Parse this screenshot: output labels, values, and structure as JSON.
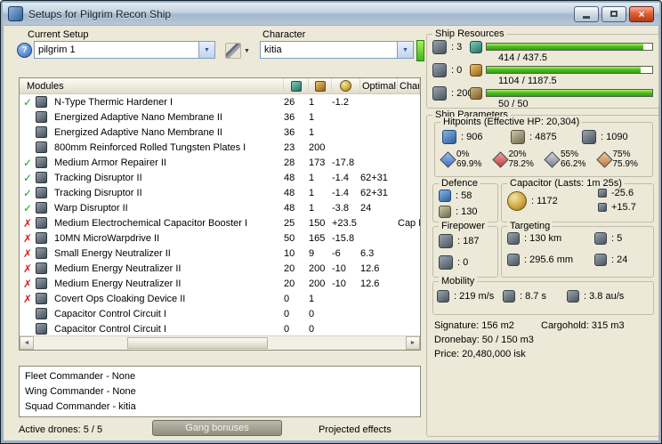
{
  "window": {
    "title": "Setups for Pilgrim Recon Ship"
  },
  "icons": {
    "help": "?",
    "dropdown": "▼",
    "close": "×",
    "scroll_left": "◄",
    "scroll_right": "►",
    "status_ok": "✓",
    "status_off": "✗"
  },
  "top": {
    "current_setup_label": "Current Setup",
    "current_setup_value": "pilgrim 1",
    "character_label": "Character",
    "character_value": "kitia"
  },
  "modules": {
    "header_modules": "Modules",
    "header_optimal": "Optimal",
    "header_charge": "Char",
    "rows": [
      {
        "status": "ok",
        "name": "N-Type Thermic Hardener I",
        "cpu": "26",
        "pg": "1",
        "cap": "-1.2",
        "optimal": "",
        "charge": ""
      },
      {
        "status": "none",
        "name": "Energized Adaptive Nano Membrane II",
        "cpu": "36",
        "pg": "1",
        "cap": "",
        "optimal": "",
        "charge": ""
      },
      {
        "status": "none",
        "name": "Energized Adaptive Nano Membrane II",
        "cpu": "36",
        "pg": "1",
        "cap": "",
        "optimal": "",
        "charge": ""
      },
      {
        "status": "none",
        "name": "800mm Reinforced Rolled Tungsten Plates I",
        "cpu": "23",
        "pg": "200",
        "cap": "",
        "optimal": "",
        "charge": ""
      },
      {
        "status": "ok",
        "name": "Medium Armor Repairer II",
        "cpu": "28",
        "pg": "173",
        "cap": "-17.8",
        "optimal": "",
        "charge": ""
      },
      {
        "status": "ok",
        "name": "Tracking Disruptor II",
        "cpu": "48",
        "pg": "1",
        "cap": "-1.4",
        "optimal": "62+31",
        "charge": ""
      },
      {
        "status": "ok",
        "name": "Tracking Disruptor II",
        "cpu": "48",
        "pg": "1",
        "cap": "-1.4",
        "optimal": "62+31",
        "charge": ""
      },
      {
        "status": "ok",
        "name": "Warp Disruptor II",
        "cpu": "48",
        "pg": "1",
        "cap": "-3.8",
        "optimal": "24",
        "charge": ""
      },
      {
        "status": "off",
        "name": "Medium Electrochemical Capacitor Booster I",
        "cpu": "25",
        "pg": "150",
        "cap": "+23.5",
        "optimal": "",
        "charge": "Cap B"
      },
      {
        "status": "off",
        "name": "10MN MicroWarpdrive II",
        "cpu": "50",
        "pg": "165",
        "cap": "-15.8",
        "optimal": "",
        "charge": ""
      },
      {
        "status": "off",
        "name": "Small Energy Neutralizer II",
        "cpu": "10",
        "pg": "9",
        "cap": "-6",
        "optimal": "6.3",
        "charge": ""
      },
      {
        "status": "off",
        "name": "Medium Energy Neutralizer II",
        "cpu": "20",
        "pg": "200",
        "cap": "-10",
        "optimal": "12.6",
        "charge": ""
      },
      {
        "status": "off",
        "name": "Medium Energy Neutralizer II",
        "cpu": "20",
        "pg": "200",
        "cap": "-10",
        "optimal": "12.6",
        "charge": ""
      },
      {
        "status": "off",
        "name": "Covert Ops Cloaking Device II",
        "cpu": "0",
        "pg": "1",
        "cap": "",
        "optimal": "",
        "charge": ""
      },
      {
        "status": "none",
        "name": "Capacitor Control Circuit I",
        "cpu": "0",
        "pg": "0",
        "cap": "",
        "optimal": "",
        "charge": ""
      },
      {
        "status": "none",
        "name": "Capacitor Control Circuit I",
        "cpu": "0",
        "pg": "0",
        "cap": "",
        "optimal": "",
        "charge": ""
      }
    ]
  },
  "commanders": [
    {
      "label": "Fleet Commander - None"
    },
    {
      "label": "Wing Commander - None"
    },
    {
      "label": "Squad Commander - kitia"
    }
  ],
  "bottom": {
    "active_drones": "Active drones: 5 / 5",
    "gang_bonuses": "Gang bonuses",
    "projected_effects": "Projected effects"
  },
  "resources": {
    "title": "Ship Resources",
    "turrets": ": 3",
    "launchers": ": 0",
    "calibration": ": 200",
    "bars": [
      {
        "label": "414 / 437.5",
        "pct": 94.6
      },
      {
        "label": "1104 / 1187.5",
        "pct": 93
      },
      {
        "label": "50 / 50",
        "pct": 100
      }
    ]
  },
  "parameters": {
    "title": "Ship Parameters",
    "hitpoints": {
      "title": "Hitpoints (Effective HP: 20,304)",
      "shield": ": 906",
      "armor": ": 4875",
      "hull": ": 1090",
      "resists": [
        {
          "type": "em",
          "shield": "0%",
          "armor": "69.9%"
        },
        {
          "type": "th",
          "shield": "20%",
          "armor": "78.2%"
        },
        {
          "type": "ki",
          "shield": "55%",
          "armor": "66.2%"
        },
        {
          "type": "ex",
          "shield": "75%",
          "armor": "75.9%"
        }
      ]
    },
    "defence": {
      "title": "Defence",
      "shield_recharge": ": 58",
      "armor_repair": ": 130"
    },
    "capacitor": {
      "title": "Capacitor (Lasts: 1m 25s)",
      "amount": ": 1172",
      "drain": "-25.6",
      "peak": "+15.7"
    },
    "firepower": {
      "title": "Firepower",
      "volley": ": 187",
      "dps": ": 0"
    },
    "targeting": {
      "title": "Targeting",
      "range": ": 130 km",
      "max_targets": ": 5",
      "scan_res": ": 295.6 mm",
      "sensor_strength": ": 24"
    },
    "mobility": {
      "title": "Mobility",
      "speed": ": 219 m/s",
      "align": ": 8.7 s",
      "warp": ": 3.8 au/s"
    },
    "signature": "Signature: 156 m2",
    "cargohold": "Cargohold: 315 m3",
    "dronebay": "Dronebay: 50 / 150 m3",
    "price": "Price: 20,480,000 isk"
  }
}
